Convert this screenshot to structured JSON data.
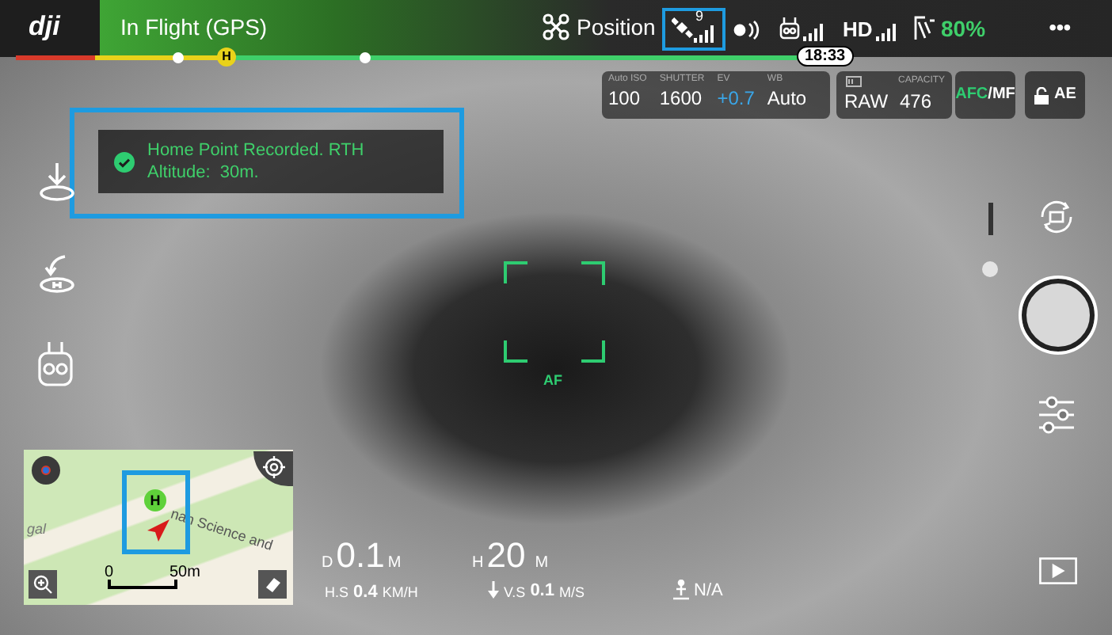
{
  "top_bar": {
    "logo": "dji",
    "flight_status": "In Flight (GPS)",
    "flight_mode": "Position",
    "gps_satellites": "9",
    "video_link": "HD",
    "battery": "80%",
    "menu": "•••"
  },
  "flight_timeline": {
    "home_marker": "H",
    "time_left": "18:33"
  },
  "camera_settings": {
    "fields": [
      {
        "label": "Auto ISO",
        "value": "100",
        "highlight": false
      },
      {
        "label": "SHUTTER",
        "value": "1600",
        "highlight": false
      },
      {
        "label": "EV",
        "value": "+0.7",
        "highlight": true
      },
      {
        "label": "WB",
        "value": "Auto",
        "highlight": false
      }
    ],
    "format": "RAW",
    "capacity_label": "CAPACITY",
    "capacity": "476",
    "focus_active": "AFC",
    "focus_sep": "/",
    "focus_other": "MF",
    "ae": "AE"
  },
  "notification": {
    "text": "Home Point Recorded. RTH Altitude:  30m."
  },
  "focus_frame": {
    "label": "AF"
  },
  "map": {
    "street_label": "nan Science and",
    "place_label": "gal",
    "home_marker": "H",
    "scale_start": "0",
    "scale_end": "50m"
  },
  "telemetry": {
    "distance": {
      "label": "D",
      "value": "0.1",
      "unit": "M"
    },
    "height": {
      "label": "H",
      "value": "20",
      "unit": "M"
    },
    "horizontal_speed": {
      "label": "H.S",
      "value": "0.4",
      "unit": "KM/H"
    },
    "vertical_speed": {
      "label": "V.S",
      "value": "0.1",
      "unit": "M/S"
    },
    "vision": "N/A"
  }
}
